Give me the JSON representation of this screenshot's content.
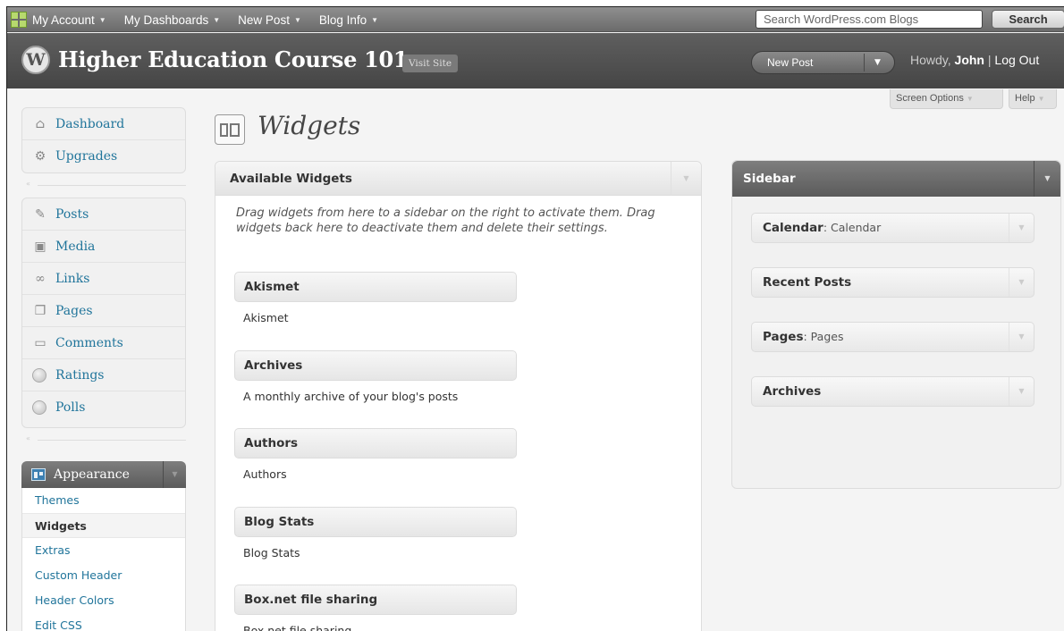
{
  "admin_bar": {
    "menus": [
      {
        "label": "My Account"
      },
      {
        "label": "My Dashboards"
      },
      {
        "label": "New Post"
      },
      {
        "label": "Blog Info"
      }
    ],
    "search_placeholder": "Search WordPress.com Blogs",
    "search_button": "Search"
  },
  "header": {
    "logo_letter": "W",
    "site_title": "Higher Education Course 101",
    "visit_site": "Visit Site",
    "new_post": "New Post",
    "howdy_prefix": "Howdy, ",
    "user_name": "John",
    "separator": " | ",
    "log_out": "Log Out"
  },
  "screen_options": {
    "screen_options": "Screen Options",
    "help": "Help"
  },
  "menu": {
    "group1": [
      {
        "label": "Dashboard",
        "icon": "home-icon"
      },
      {
        "label": "Upgrades",
        "icon": "gear-icon"
      }
    ],
    "group2": [
      {
        "label": "Posts",
        "icon": "pushpin-icon"
      },
      {
        "label": "Media",
        "icon": "media-icon"
      },
      {
        "label": "Links",
        "icon": "link-icon"
      },
      {
        "label": "Pages",
        "icon": "pages-icon"
      },
      {
        "label": "Comments",
        "icon": "comment-icon"
      },
      {
        "label": "Ratings",
        "icon": "circle-icon"
      },
      {
        "label": "Polls",
        "icon": "circle-icon"
      }
    ],
    "appearance": {
      "label": "Appearance",
      "items": [
        {
          "label": "Themes"
        },
        {
          "label": "Widgets"
        },
        {
          "label": "Extras"
        },
        {
          "label": "Custom Header"
        },
        {
          "label": "Header Colors"
        },
        {
          "label": "Edit CSS"
        }
      ],
      "current": "Widgets"
    }
  },
  "page": {
    "title": "Widgets"
  },
  "available": {
    "title": "Available Widgets",
    "description": "Drag widgets from here to a sidebar on the right to activate them. Drag widgets back here to deactivate them and delete their settings.",
    "widgets": [
      {
        "name": "Akismet",
        "desc": "Akismet"
      },
      {
        "name": "Archives",
        "desc": "A monthly archive of your blog's posts"
      },
      {
        "name": "Authors",
        "desc": "Authors"
      },
      {
        "name": "Blog Stats",
        "desc": "Blog Stats"
      },
      {
        "name": "Box.net file sharing",
        "desc": "Box.net file sharing"
      }
    ]
  },
  "sidebar": {
    "title": "Sidebar",
    "widgets": [
      {
        "name": "Calendar",
        "sub": ": Calendar"
      },
      {
        "name": "Recent Posts",
        "sub": ""
      },
      {
        "name": "Pages",
        "sub": ": Pages"
      },
      {
        "name": "Archives",
        "sub": ""
      }
    ]
  }
}
